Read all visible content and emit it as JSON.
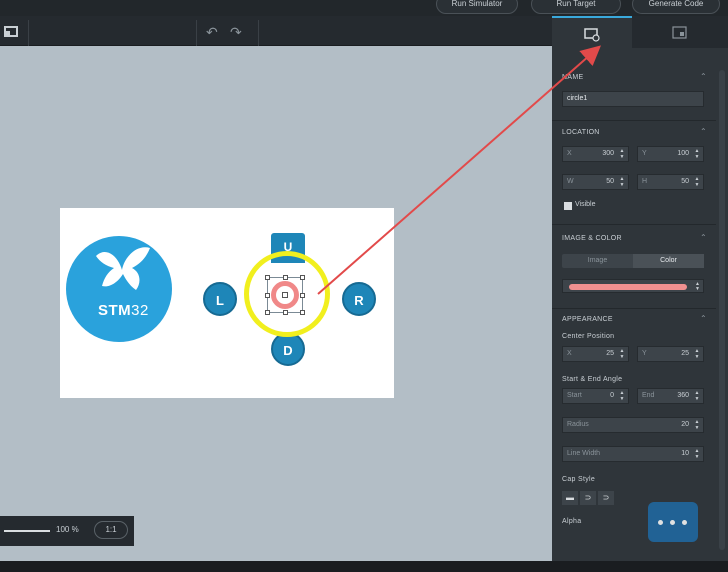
{
  "topbar": {
    "run_simulator": "Run Simulator",
    "run_target": "Run Target",
    "generate_code": "Generate Code"
  },
  "toolbar": {
    "icons": [
      "layout-icon",
      "undo-icon",
      "redo-icon"
    ]
  },
  "canvas": {
    "logo_text_bold": "STM",
    "logo_text_light": "32",
    "buttons": {
      "up": "U",
      "left": "L",
      "right": "R",
      "down": "D"
    }
  },
  "zoom": {
    "value": "100 %",
    "fit": "1:1"
  },
  "panel": {
    "tabs": [
      "properties-tab",
      "interactions-tab"
    ],
    "name_section": {
      "title": "NAME",
      "value": "circle1"
    },
    "location_section": {
      "title": "LOCATION",
      "x_label": "X",
      "x": "300",
      "y_label": "Y",
      "y": "100",
      "w_label": "W",
      "w": "50",
      "h_label": "H",
      "h": "50",
      "visible_label": "Visible"
    },
    "image_color_section": {
      "title": "IMAGE & COLOR",
      "option_image": "Image",
      "option_color": "Color",
      "color": "#f09090"
    },
    "appearance_section": {
      "title": "APPEARANCE",
      "center_position_label": "Center Position",
      "cx_label": "X",
      "cx": "25",
      "cy_label": "Y",
      "cy": "25",
      "angle_label": "Start & End Angle",
      "start_label": "Start",
      "start": "0",
      "end_label": "End",
      "end": "360",
      "radius_label": "Radius",
      "radius": "20",
      "line_width_label": "Line Width",
      "line_width": "10",
      "cap_style_label": "Cap Style",
      "alpha_label": "Alpha"
    }
  },
  "colors": {
    "accent": "#3aa9dc",
    "annotation_arrow": "#e24a4a",
    "highlight_ring": "#f1ef1e",
    "button_blue": "#1e86b8",
    "logo_blue": "#2aa2dc"
  }
}
